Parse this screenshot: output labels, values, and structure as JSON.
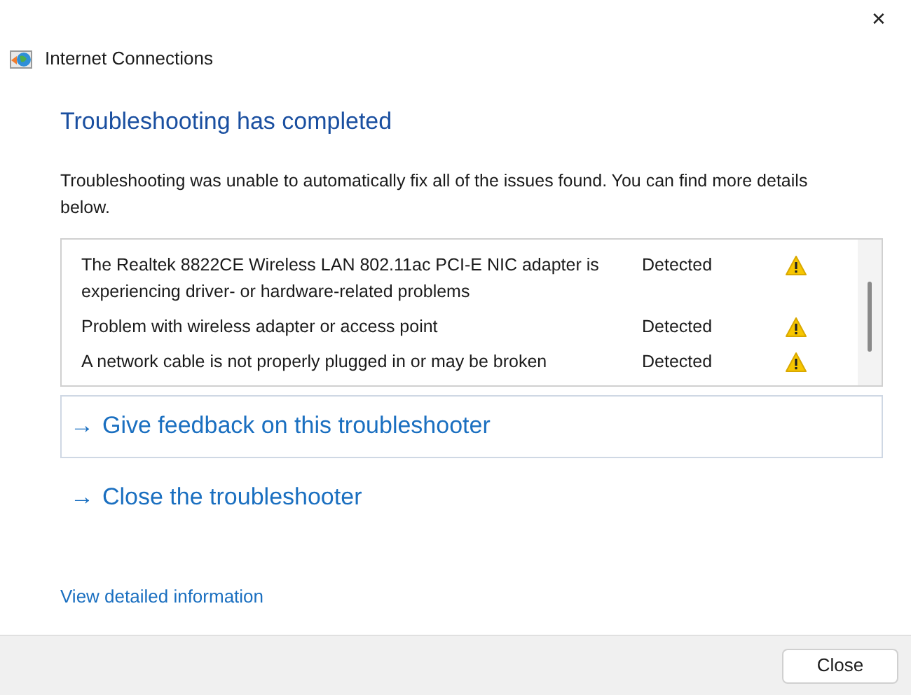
{
  "window": {
    "title": "Internet Connections",
    "close_glyph": "✕"
  },
  "heading": "Troubleshooting has completed",
  "description": "Troubleshooting was unable to automatically fix all of the issues found. You can find more details below.",
  "issues": [
    {
      "text": "The Realtek 8822CE Wireless LAN 802.11ac PCI-E NIC adapter is experiencing driver- or hardware-related problems",
      "status": "Detected"
    },
    {
      "text": "Problem with wireless adapter or access point",
      "status": "Detected"
    },
    {
      "text": "A network cable is not properly plugged in or may be broken",
      "status": "Detected"
    }
  ],
  "links": [
    {
      "label": "Give feedback on this troubleshooter",
      "selected": true
    },
    {
      "label": "Close the troubleshooter",
      "selected": false
    }
  ],
  "arrow_glyph": "→",
  "details_link": "View detailed information",
  "footer_button": "Close"
}
